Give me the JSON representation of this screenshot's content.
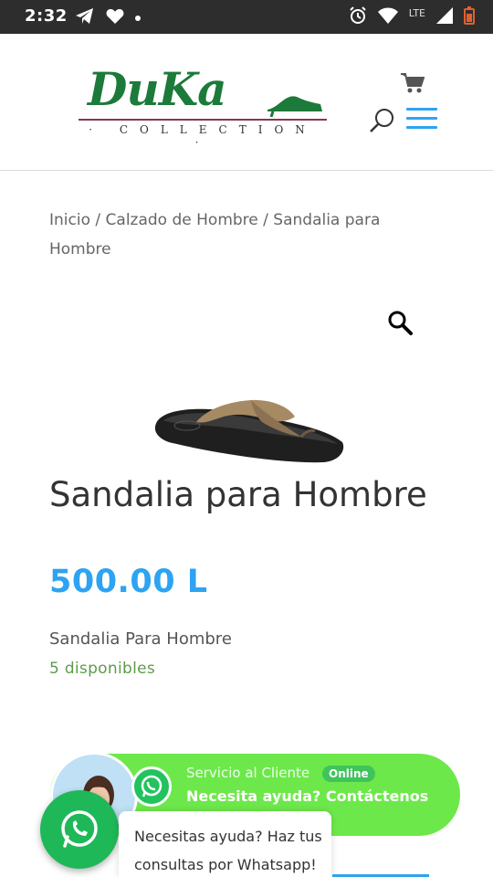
{
  "status_bar": {
    "time": "2:32",
    "network": "LTE",
    "icons": [
      "telegram-icon",
      "heart-icon",
      "notification-dot-icon",
      "alarm-icon",
      "wifi-icon",
      "signal-icon",
      "battery-icon"
    ]
  },
  "header": {
    "logo_text": "DuKa",
    "logo_sub": "· COLLECTION ·",
    "brand_colors": {
      "green": "#1c7a3a",
      "maroon": "#8a3550"
    },
    "icons": [
      "cart-icon",
      "search-icon",
      "menu-icon"
    ]
  },
  "breadcrumb": {
    "items": [
      "Inicio",
      "Calzado de Hombre",
      "Sandalia para Hombre"
    ],
    "separator": " / "
  },
  "product": {
    "title": "Sandalia para Hombre",
    "price": "500.00 L",
    "short_description": "Sandalia Para Hombre",
    "stock": "5 disponibles"
  },
  "whatsapp": {
    "service": "Servicio al Cliente",
    "status": "Online",
    "help": "Necesita ayuda? Contáctenos",
    "tooltip": "Necesitas ayuda? Haz tus consultas por Whatsapp!"
  },
  "colors": {
    "accent": "#2ea3f2",
    "whatsapp_green": "#1fb858",
    "banner_green": "#6de84a",
    "stock_green": "#5d9b4a"
  }
}
